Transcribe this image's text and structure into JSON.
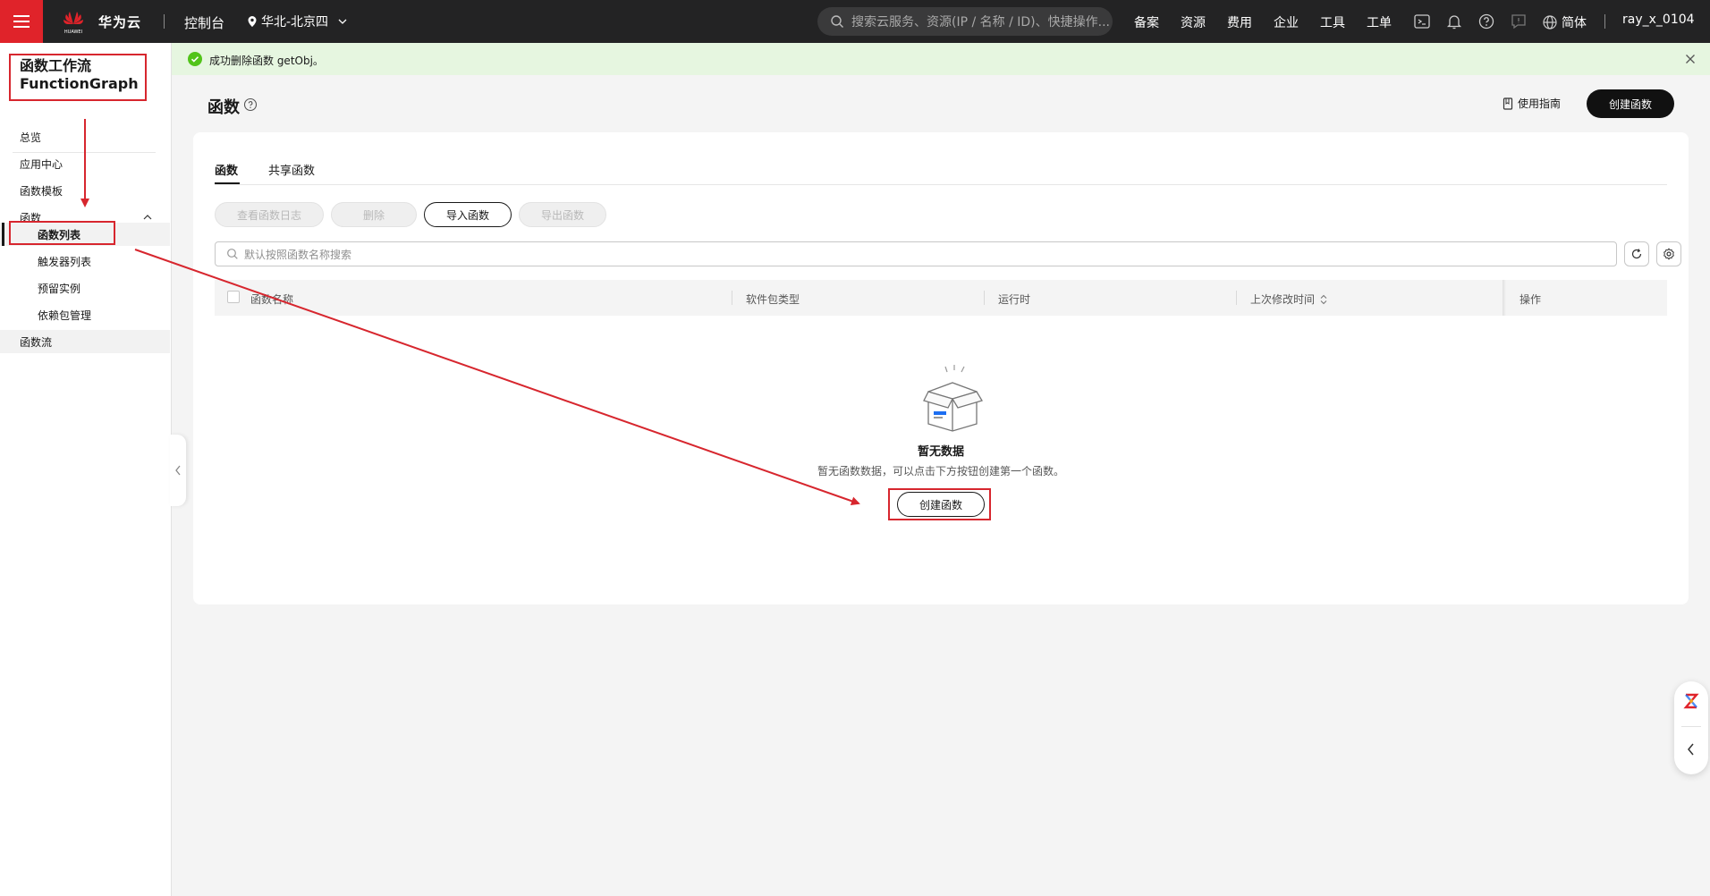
{
  "topbar": {
    "brand": "华为云",
    "logo_text": "HUAWEI",
    "console": "控制台",
    "region": "华北-北京四",
    "search_placeholder": "搜索云服务、资源(IP / 名称 / ID)、快捷操作...",
    "nav": [
      "备案",
      "资源",
      "费用",
      "企业",
      "工具",
      "工单"
    ],
    "language": "简体",
    "user": "ray_x_0104"
  },
  "sidebar": {
    "service_title_line1": "函数工作流",
    "service_title_line2": "FunctionGraph",
    "items": [
      {
        "label": "总览"
      },
      {
        "label": "应用中心"
      },
      {
        "label": "函数模板"
      },
      {
        "label": "函数"
      },
      {
        "label": "函数列表"
      },
      {
        "label": "触发器列表"
      },
      {
        "label": "预留实例"
      },
      {
        "label": "依赖包管理"
      },
      {
        "label": "函数流"
      }
    ]
  },
  "banner": {
    "message": "成功删除函数 getObj。",
    "status_color": "#52c41a"
  },
  "page": {
    "title": "函数",
    "guide": "使用指南",
    "create_button": "创建函数"
  },
  "tabs": [
    {
      "label": "函数",
      "active": true
    },
    {
      "label": "共享函数",
      "active": false
    }
  ],
  "actions": [
    {
      "label": "查看函数日志",
      "enabled": false
    },
    {
      "label": "删除",
      "enabled": false
    },
    {
      "label": "导入函数",
      "enabled": true
    },
    {
      "label": "导出函数",
      "enabled": false
    }
  ],
  "search": {
    "placeholder": "默认按照函数名称搜索"
  },
  "table": {
    "columns": [
      "函数名称",
      "软件包类型",
      "运行时",
      "上次修改时间",
      "操作"
    ]
  },
  "empty": {
    "title": "暂无数据",
    "description": "暂无函数数据，可以点击下方按钮创建第一个函数。",
    "button": "创建函数"
  },
  "colors": {
    "accent": "#e0232a",
    "annotation": "#d7262e"
  }
}
